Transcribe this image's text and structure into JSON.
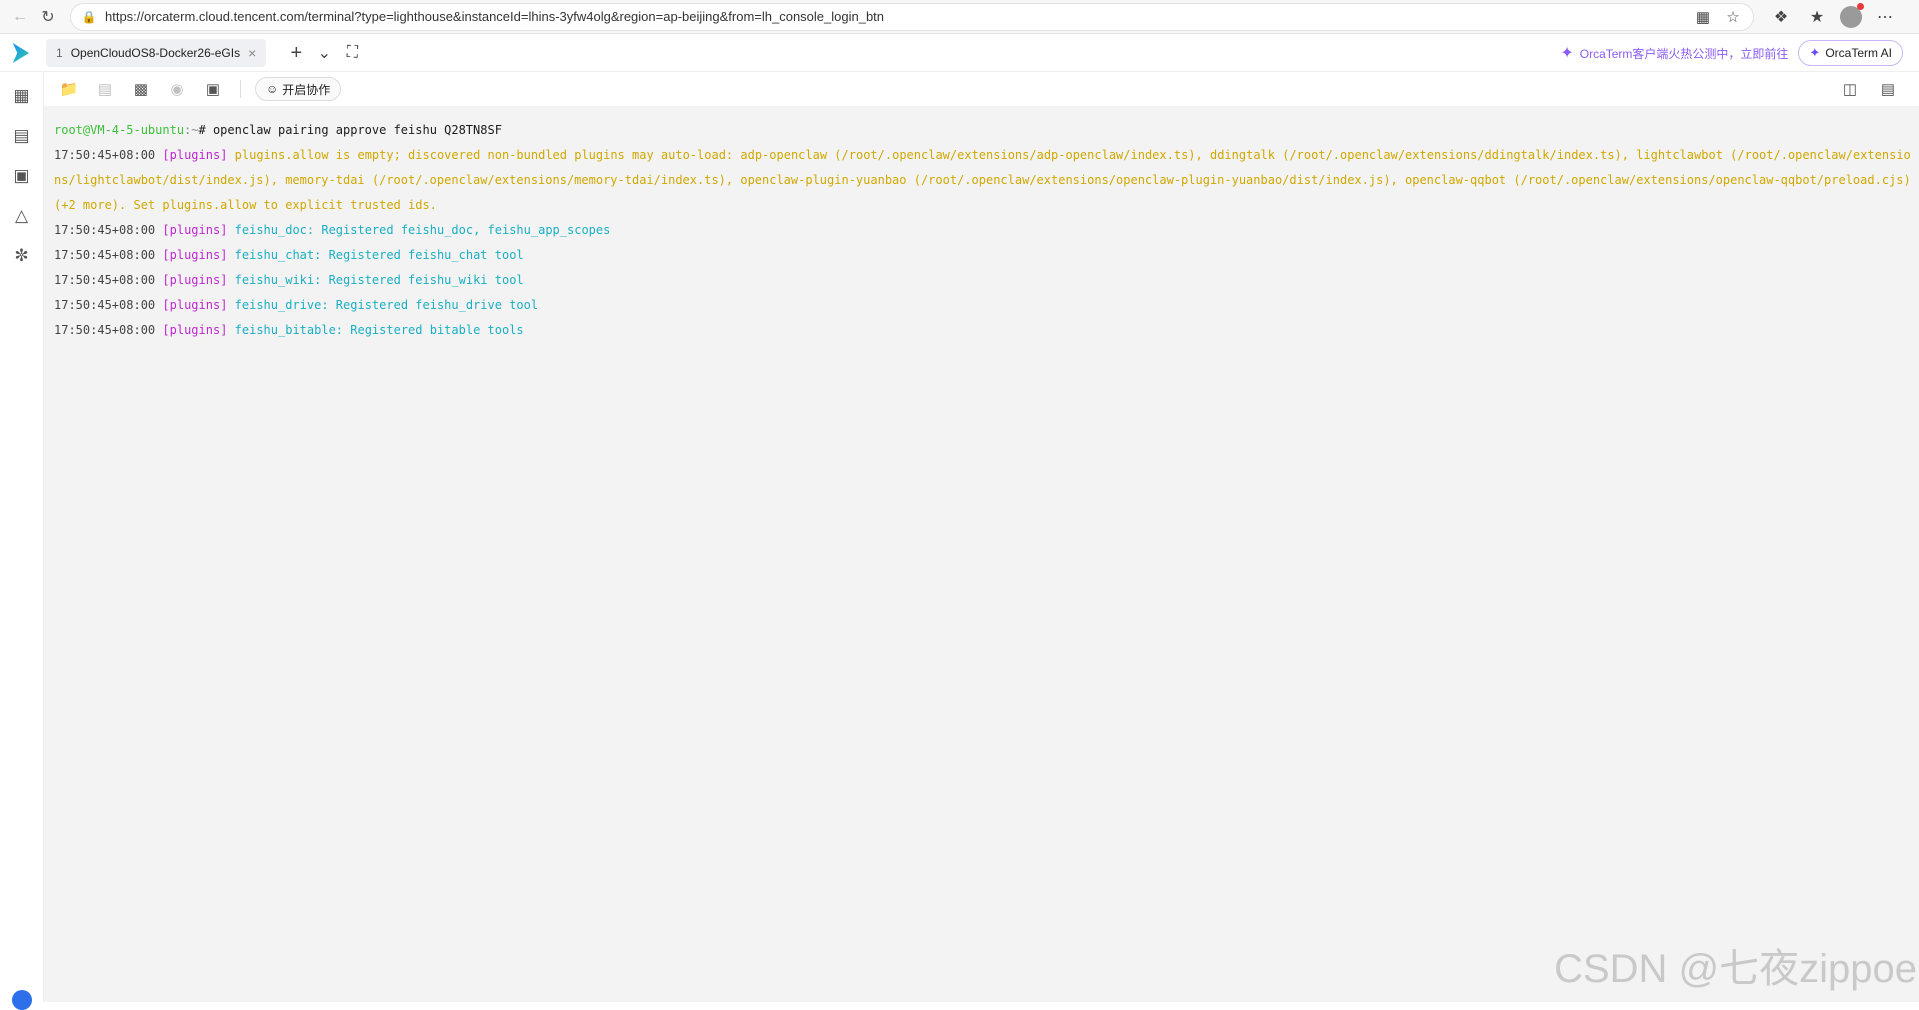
{
  "browser": {
    "url": "https://orcaterm.cloud.tencent.com/terminal?type=lighthouse&instanceId=lhins-3yfw4olg&region=ap-beijing&from=lh_console_login_btn",
    "icons": [
      "back-icon",
      "refresh-icon",
      "lock-icon",
      "apps-icon",
      "star-icon",
      "extensions-icon",
      "favorites-icon",
      "profile-avatar",
      "more-icon"
    ]
  },
  "header": {
    "tab_number": "1",
    "tab_title": "OpenCloudOS8-Docker26-eGIs",
    "promo_text": "OrcaTerm客户端火热公测中，立即前往",
    "ai_button": "OrcaTerm AI"
  },
  "toolbar": {
    "collab_label": "开启协作"
  },
  "terminal": {
    "prompt_user": "root@VM-4-5-ubuntu",
    "prompt_path": ":~",
    "prompt_cmd": "# openclaw pairing approve feishu Q28TN8SF",
    "warn_time": "17:50:45+08:00",
    "warn_tag": "[plugins]",
    "warn_text": "plugins.allow is empty; discovered non-bundled plugins may auto-load: adp-openclaw (/root/.openclaw/extensions/adp-openclaw/index.ts), ddingtalk (/root/.openclaw/extensions/ddingtalk/index.ts), lightclawbot (/root/.openclaw/extensions/lightclawbot/dist/index.js), memory-tdai (/root/.openclaw/extensions/memory-tdai/index.ts), openclaw-plugin-yuanbao (/root/.openclaw/extensions/openclaw-plugin-yuanbao/dist/index.js), openclaw-qqbot (/root/.openclaw/extensions/openclaw-qqbot/preload.cjs) (+2 more). Set plugins.allow to explicit trusted ids.",
    "logs": [
      {
        "time": "17:50:45+08:00",
        "tag": "[plugins]",
        "text": "feishu_doc: Registered feishu_doc, feishu_app_scopes"
      },
      {
        "time": "17:50:45+08:00",
        "tag": "[plugins]",
        "text": "feishu_chat: Registered feishu_chat tool"
      },
      {
        "time": "17:50:45+08:00",
        "tag": "[plugins]",
        "text": "feishu_wiki: Registered feishu_wiki tool"
      },
      {
        "time": "17:50:45+08:00",
        "tag": "[plugins]",
        "text": "feishu_drive: Registered feishu_drive tool"
      },
      {
        "time": "17:50:45+08:00",
        "tag": "[plugins]",
        "text": "feishu_bitable: Registered bitable tools"
      }
    ]
  },
  "watermark": "CSDN @七夜zippoe",
  "colors": {
    "prompt_green": "#3cc03c",
    "plugin_tag": "#c026d3",
    "warning_yellow": "#d0a800",
    "info_cyan": "#1aafc4",
    "ai_accent": "#8b5cf6"
  }
}
